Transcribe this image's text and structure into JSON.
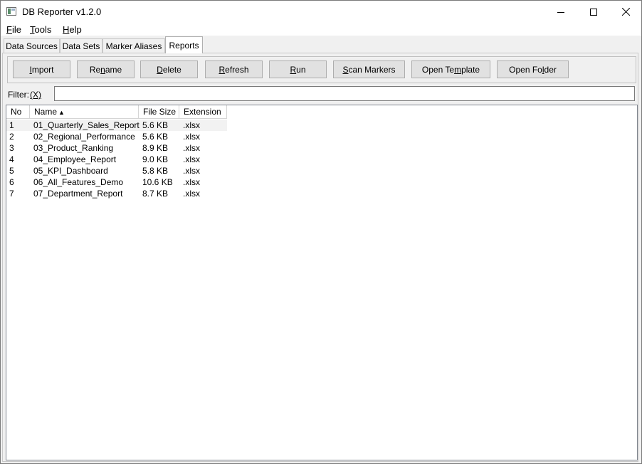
{
  "window": {
    "title": "DB Reporter v1.2.0",
    "controls": {
      "minimize": "minimize-icon",
      "maximize": "maximize-icon",
      "close": "close-icon"
    }
  },
  "menu": [
    {
      "accel": "F",
      "rest": "ile"
    },
    {
      "accel": "T",
      "rest": "ools"
    },
    {
      "accel": "H",
      "rest": "elp"
    }
  ],
  "tabs": [
    "Data Sources",
    "Data Sets",
    "Marker Aliases",
    "Reports"
  ],
  "active_tab": "Reports",
  "toolbar": [
    {
      "pre": "",
      "accel": "I",
      "post": "mport"
    },
    {
      "pre": "Re",
      "accel": "n",
      "post": "ame"
    },
    {
      "pre": "",
      "accel": "D",
      "post": "elete"
    },
    {
      "pre": "",
      "accel": "R",
      "post": "efresh"
    },
    {
      "pre": "",
      "accel": "R",
      "post": "un"
    },
    {
      "pre": "",
      "accel": "S",
      "post": "can Markers"
    },
    {
      "pre": "Open Te",
      "accel": "m",
      "post": "plate"
    },
    {
      "pre": "Open Fo",
      "accel": "l",
      "post": "der"
    }
  ],
  "filter": {
    "label": "Filter:",
    "clear": "(X)",
    "value": ""
  },
  "table": {
    "columns": [
      "No",
      "Name",
      "File Size",
      "Extension"
    ],
    "sort_indicator": "▲",
    "rows": [
      {
        "no": "1",
        "name": "01_Quarterly_Sales_Report",
        "size": "5.6 KB",
        "ext": ".xlsx"
      },
      {
        "no": "2",
        "name": "02_Regional_Performance",
        "size": "5.6 KB",
        "ext": ".xlsx"
      },
      {
        "no": "3",
        "name": "03_Product_Ranking",
        "size": "8.9 KB",
        "ext": ".xlsx"
      },
      {
        "no": "4",
        "name": "04_Employee_Report",
        "size": "9.0 KB",
        "ext": ".xlsx"
      },
      {
        "no": "5",
        "name": "05_KPI_Dashboard",
        "size": "5.8 KB",
        "ext": ".xlsx"
      },
      {
        "no": "6",
        "name": "06_All_Features_Demo",
        "size": "10.6 KB",
        "ext": ".xlsx"
      },
      {
        "no": "7",
        "name": "07_Department_Report",
        "size": "8.7 KB",
        "ext": ".xlsx"
      }
    ]
  }
}
